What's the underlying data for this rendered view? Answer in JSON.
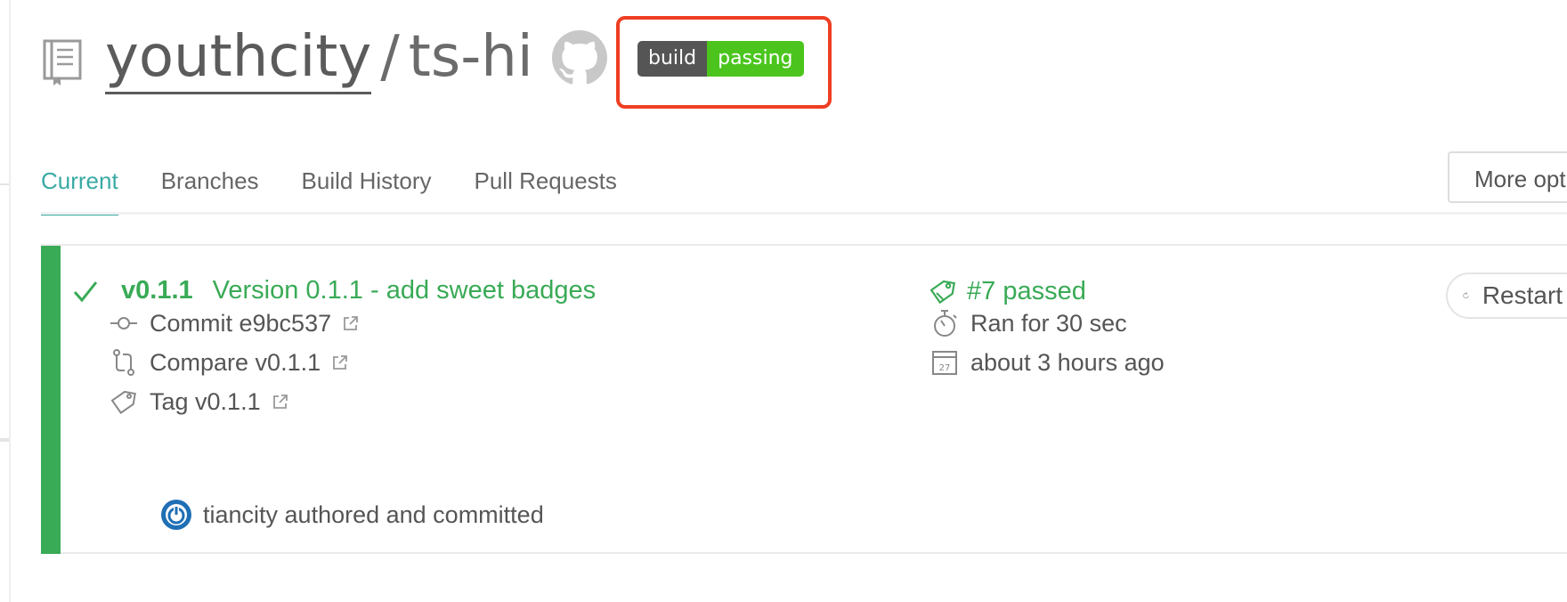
{
  "repo": {
    "owner": "youthcity",
    "separator": "/",
    "name": "ts-hi",
    "icons": {
      "repo": "repo-book-icon",
      "github": "github-icon"
    }
  },
  "badge": {
    "label": "build",
    "status": "passing",
    "colors": {
      "label": "#555555",
      "status": "#4bc51d",
      "highlight": "#ef3e22"
    }
  },
  "tabs": [
    {
      "label": "Current",
      "active": true
    },
    {
      "label": "Branches",
      "active": false
    },
    {
      "label": "Build History",
      "active": false
    },
    {
      "label": "Pull Requests",
      "active": false
    }
  ],
  "more_options": {
    "label": "More options"
  },
  "build": {
    "branch": "v0.1.1",
    "message": "Version 0.1.1 - add sweet badges",
    "status_text": "#7 passed",
    "restart_label": "Restart build",
    "commit": {
      "label": "Commit e9bc537",
      "icon": "commit-icon"
    },
    "compare": {
      "label": "Compare v0.1.1",
      "icon": "compare-icon"
    },
    "tag": {
      "label": "Tag v0.1.1",
      "icon": "tag-icon"
    },
    "duration": {
      "label": "Ran for 30 sec",
      "icon": "stopwatch-icon"
    },
    "finished": {
      "label": "about 3 hours ago",
      "icon": "calendar-icon",
      "calendar_day": "27"
    },
    "author": "tiancity authored and committed",
    "colors": {
      "passed": "#39aa56",
      "tab_active": "#39aaa4"
    }
  }
}
